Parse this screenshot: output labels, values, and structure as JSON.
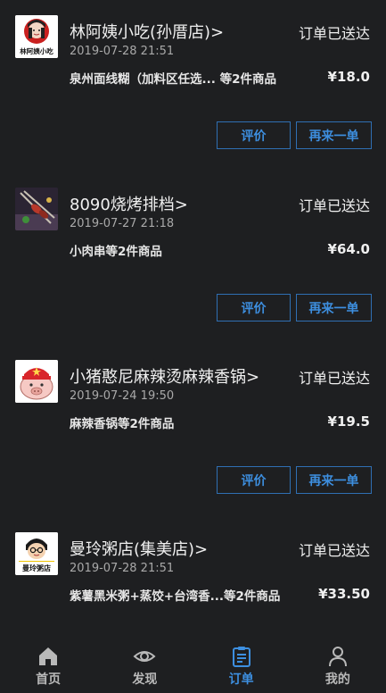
{
  "orders": [
    {
      "shop": "林阿姨小吃(孙厝店)>",
      "status": "订单已送达",
      "time": "2019-07-28 21:51",
      "summary": "泉州面线糊（加料区任选... 等2件商品",
      "price": "¥18.0",
      "review": "评价",
      "reorder": "再来一单",
      "logo_text": "林阿姨小吃"
    },
    {
      "shop": "8090烧烤排档>",
      "status": "订单已送达",
      "time": "2019-07-27 21:18",
      "summary": "小肉串等2件商品",
      "price": "¥64.0",
      "review": "评价",
      "reorder": "再来一单"
    },
    {
      "shop": "小猪憨尼麻辣烫麻辣香锅>",
      "status": "订单已送达",
      "time": "2019-07-24 19:50",
      "summary": "麻辣香锅等2件商品",
      "price": "¥19.5",
      "review": "评价",
      "reorder": "再来一单"
    },
    {
      "shop": "曼玲粥店(集美店)>",
      "status": "订单已送达",
      "time": "2019-07-28 21:51",
      "summary": "紫薯黑米粥+蒸饺+台湾香...等2件商品",
      "price": "¥33.50",
      "logo_text": "曼玲粥店"
    }
  ],
  "tabs": [
    {
      "label": "首页",
      "icon": "home-icon"
    },
    {
      "label": "发现",
      "icon": "eye-icon"
    },
    {
      "label": "订单",
      "icon": "clipboard-icon",
      "active": true
    },
    {
      "label": "我的",
      "icon": "person-icon"
    }
  ],
  "colors": {
    "accent": "#3d8fe0",
    "background": "#1e1f21",
    "button_border": "#2f6fb3"
  }
}
